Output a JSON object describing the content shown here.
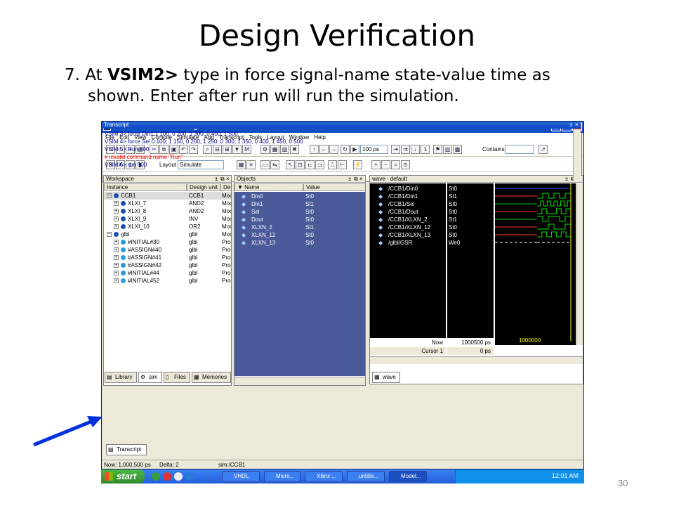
{
  "slide": {
    "title": "Design Verification",
    "instruction_num": "7.",
    "instruction_pre": "At",
    "instruction_bold": "VSIM2>",
    "instruction_line1_rest": "type in force signal-name state-value time as",
    "instruction_line2": "shown. Enter after run will run the simulation.",
    "page_number": "30"
  },
  "window": {
    "title": "ModelSim XE III/Starter 6.2g - Custom Xilinx Version",
    "menu": [
      "File",
      "Edit",
      "View",
      "Compile",
      "Simulate",
      "Add",
      "Transcript",
      "Tools",
      "Layout",
      "Window",
      "Help"
    ],
    "toolbar": {
      "run_length": "100 ps",
      "contains_label": "Contains",
      "layout_label": "Layout",
      "layout_value": "Simulate"
    }
  },
  "workspace": {
    "title": "Workspace",
    "columns": [
      "Instance",
      "Design unit",
      "Des"
    ],
    "rows": [
      {
        "indent": 0,
        "instance": "CCB1",
        "unit": "CCB1",
        "desc": "Moc"
      },
      {
        "indent": 1,
        "instance": "XLXI_7",
        "unit": "AND2",
        "desc": "Moc"
      },
      {
        "indent": 1,
        "instance": "XLXI_8",
        "unit": "AND2",
        "desc": "Moc"
      },
      {
        "indent": 1,
        "instance": "XLXI_9",
        "unit": "INV",
        "desc": "Moc"
      },
      {
        "indent": 1,
        "instance": "XLXI_10",
        "unit": "OR2",
        "desc": "Moc"
      },
      {
        "indent": 0,
        "instance": "glbl",
        "unit": "glbl",
        "desc": "Moc"
      },
      {
        "indent": 1,
        "instance": "#INITIAL#30",
        "unit": "glbl",
        "desc": "Proc"
      },
      {
        "indent": 1,
        "instance": "#ASSIGN#40",
        "unit": "glbl",
        "desc": "Proc"
      },
      {
        "indent": 1,
        "instance": "#ASSIGN#41",
        "unit": "glbl",
        "desc": "Proc"
      },
      {
        "indent": 1,
        "instance": "#ASSIGN#42",
        "unit": "glbl",
        "desc": "Proc"
      },
      {
        "indent": 1,
        "instance": "#INITIAL#44",
        "unit": "glbl",
        "desc": "Proc"
      },
      {
        "indent": 1,
        "instance": "#INITIAL#52",
        "unit": "glbl",
        "desc": "Proc"
      }
    ],
    "tabs": [
      "Library",
      "sim",
      "Files",
      "Memories"
    ]
  },
  "objects": {
    "title": "Objects",
    "columns": [
      "Name",
      "Value"
    ],
    "rows": [
      {
        "name": "Din0",
        "value": "St0"
      },
      {
        "name": "Din1",
        "value": "St1"
      },
      {
        "name": "Sel",
        "value": "St0"
      },
      {
        "name": "Dout",
        "value": "St0"
      },
      {
        "name": "XLXN_2",
        "value": "St1"
      },
      {
        "name": "XLXN_12",
        "value": "St0"
      },
      {
        "name": "XLXN_13",
        "value": "St0"
      }
    ]
  },
  "wave": {
    "title": "wave - default",
    "signals": [
      {
        "name": "/CCB1/Din0",
        "value": "St0"
      },
      {
        "name": "/CCB1/Din1",
        "value": "St1"
      },
      {
        "name": "/CCB1/Sel",
        "value": "St0"
      },
      {
        "name": "/CCB1/Dout",
        "value": "St0"
      },
      {
        "name": "/CCB1/XLXN_2",
        "value": "St1"
      },
      {
        "name": "/CCB1/XLXN_12",
        "value": "St0"
      },
      {
        "name": "/CCB1/XLXN_13",
        "value": "St0"
      },
      {
        "name": "/glbl/GSR",
        "value": "We0"
      }
    ],
    "now_label": "Now",
    "now_value": "1000500 ps",
    "cursor_label": "Cursor 1",
    "cursor_value": "0 ps",
    "time_marker": "1000000",
    "tab": "wave"
  },
  "transcript": {
    "title": "Transcript",
    "lines": [
      {
        "text": "VSIM 3> force Din1 1 100, 0 200, 1 300, 0 400, 1 500",
        "color": "#000080"
      },
      {
        "text": "VSIM 4> force Sel 0 100, 1 150, 0 200, 1 250, 0 300, 1 350, 0 400, 1 450, 0 500",
        "color": "#000080"
      },
      {
        "text": "VSIM 5> Run 500",
        "color": "#000080"
      },
      {
        "text": "# invalid command name \"Run\"",
        "color": "#ff0000"
      },
      {
        "text": "VSIM 6> run 500",
        "color": "#000080"
      }
    ],
    "tab": "Transcript"
  },
  "status": {
    "now": "Now: 1,000,500 ps",
    "delta": "Delta: 2",
    "sim": "sim:/CCB1"
  },
  "taskbar": {
    "start": "start",
    "tasks": [
      "VHDL",
      "Micro...",
      "Xilinx ...",
      "untitle...",
      "Model..."
    ],
    "clock": "12:01 AM"
  }
}
